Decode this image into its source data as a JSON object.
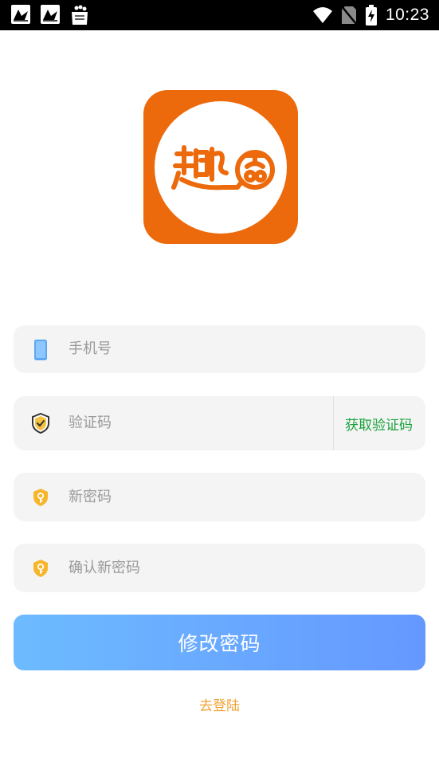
{
  "status_bar": {
    "time": "10:23",
    "icons": [
      "notification-bird-icon",
      "notification-bird-icon",
      "shopping-bag-icon",
      "wifi-icon",
      "no-sim-icon",
      "battery-charging-icon"
    ]
  },
  "logo": {
    "brand_color": "#ec6a0c"
  },
  "form": {
    "phone": {
      "placeholder": "手机号",
      "value": ""
    },
    "code": {
      "placeholder": "验证码",
      "value": "",
      "get_code_label": "获取验证码"
    },
    "new_password": {
      "placeholder": "新密码",
      "value": ""
    },
    "confirm_password": {
      "placeholder": "确认新密码",
      "value": ""
    },
    "submit_label": "修改密码",
    "login_link": "去登陆"
  },
  "colors": {
    "field_bg": "#f4f4f4",
    "placeholder": "#9a9a9a",
    "get_code": "#1aa33c",
    "button_gradient_start": "#6dbbff",
    "button_gradient_end": "#6598ff",
    "login_link": "#f0a232"
  }
}
